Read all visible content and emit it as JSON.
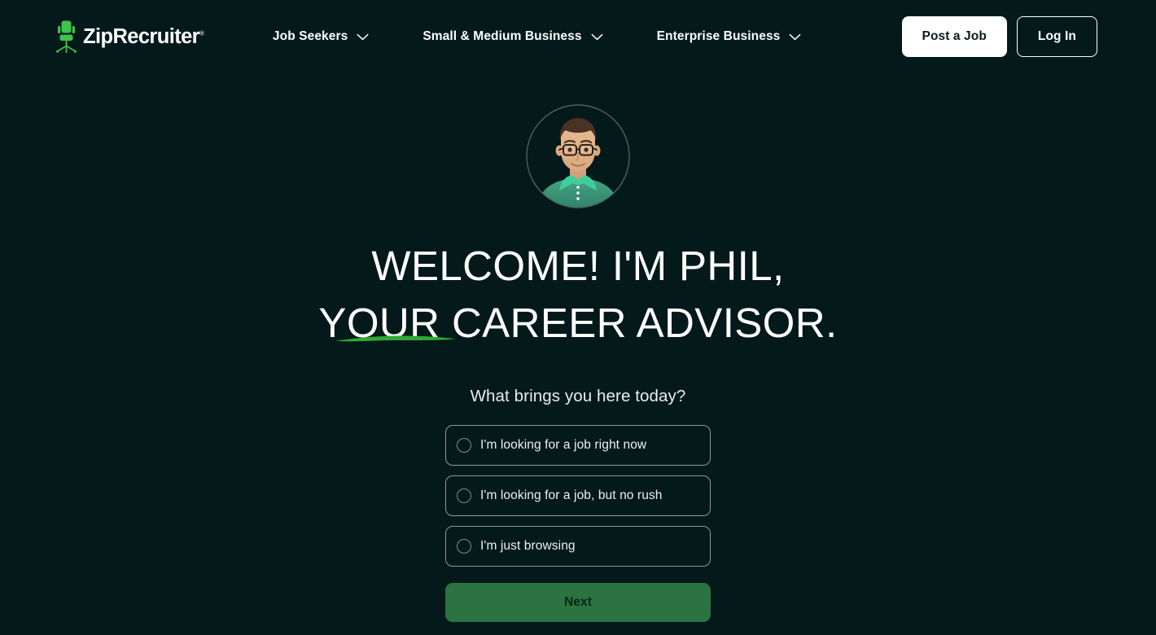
{
  "theme": {
    "background": "#04191a",
    "accent_green": "#38c64a",
    "next_button_bg": "#2b7340",
    "next_button_text": "#0d2417",
    "text_primary": "#ffffff",
    "border_muted": "#8a9b9a"
  },
  "header": {
    "logo": {
      "icon": "office-chair-icon",
      "wordmark": "ZipRecruiter",
      "registered_mark": "®"
    },
    "nav_items": [
      {
        "label": "Job Seekers",
        "icon": "chevron-down-icon"
      },
      {
        "label": "Small & Medium Business",
        "icon": "chevron-down-icon"
      },
      {
        "label": "Enterprise Business",
        "icon": "chevron-down-icon"
      }
    ],
    "post_job_label": "Post a Job",
    "login_label": "Log In"
  },
  "main": {
    "avatar": {
      "icon": "phil-advisor-avatar",
      "hair_color": "#4a3224",
      "skin_color": "#e0b189",
      "shirt_color": "#3f9a7d",
      "collar_color": "#3fcf9a",
      "ring_color": "#4a6160"
    },
    "headline_line1": "WELCOME! I'M PHIL,",
    "headline_line2": "YOUR CAREER ADVISOR.",
    "underline_icon": "green-brush-underline",
    "question": "What brings you here today?",
    "options": [
      {
        "label": "I'm looking for a job right now",
        "selected": false
      },
      {
        "label": "I'm looking for a job, but no rush",
        "selected": false
      },
      {
        "label": "I'm just browsing",
        "selected": false
      }
    ],
    "next_label": "Next"
  }
}
